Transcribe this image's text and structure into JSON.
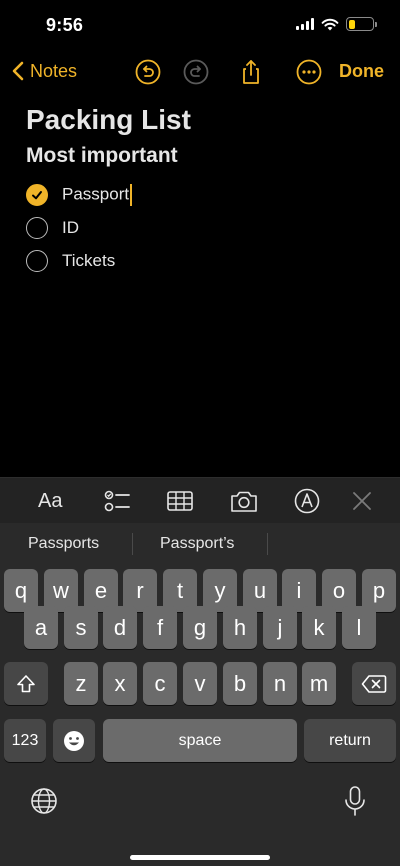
{
  "status": {
    "time": "9:56"
  },
  "nav": {
    "back_label": "Notes",
    "done_label": "Done"
  },
  "note": {
    "title": "Packing List",
    "heading": "Most important",
    "items": [
      {
        "text": "Passport",
        "checked": true
      },
      {
        "text": "ID",
        "checked": false
      },
      {
        "text": "Tickets",
        "checked": false
      }
    ]
  },
  "toolbar": {
    "format_label": "Aa"
  },
  "suggestions": [
    "Passports",
    "Passport’s"
  ],
  "keyboard": {
    "row1": [
      "q",
      "w",
      "e",
      "r",
      "t",
      "y",
      "u",
      "i",
      "o",
      "p"
    ],
    "row2": [
      "a",
      "s",
      "d",
      "f",
      "g",
      "h",
      "j",
      "k",
      "l"
    ],
    "row3": [
      "z",
      "x",
      "c",
      "v",
      "b",
      "n",
      "m"
    ],
    "numbers_label": "123",
    "space_label": "space",
    "return_label": "return"
  },
  "colors": {
    "accent": "#f0b429",
    "background": "#000000",
    "key": "#6b6b6b",
    "key_dark": "#474747"
  }
}
